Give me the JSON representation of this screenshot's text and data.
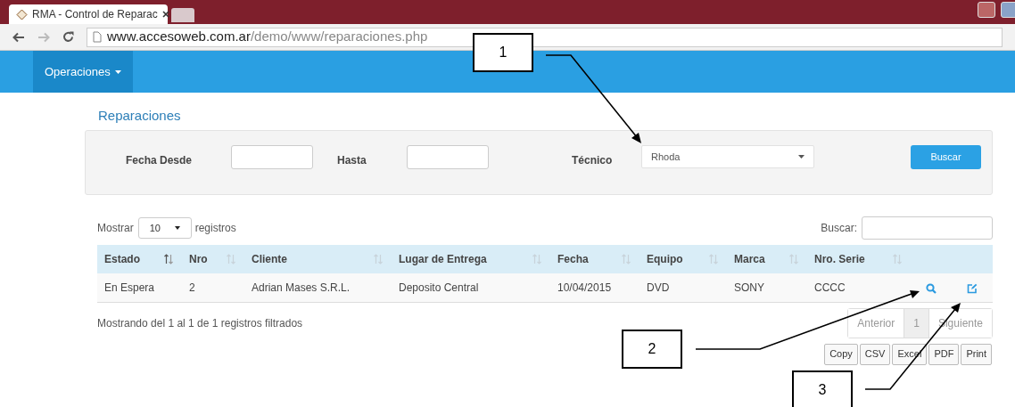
{
  "browser": {
    "tab_title": "RMA - Control de Reparac",
    "address": {
      "domain": "www.accesoweb.com.ar",
      "path": "/demo/www/reparaciones.php"
    }
  },
  "navbar": {
    "menu": "Operaciones"
  },
  "page_title": "Reparaciones",
  "filters": {
    "from_label": "Fecha Desde",
    "to_label": "Hasta",
    "tech_label": "Técnico",
    "tech_value": "Rhoda",
    "button": "Buscar"
  },
  "table_controls": {
    "show_label": "Mostrar",
    "page_size": "10",
    "records_label": "registros",
    "search_label": "Buscar:"
  },
  "table": {
    "columns": [
      {
        "label": "Estado",
        "sorted": true
      },
      {
        "label": "Nro",
        "sorted": false
      },
      {
        "label": "Cliente",
        "sorted": false
      },
      {
        "label": "Lugar de Entrega",
        "sorted": false
      },
      {
        "label": "Fecha",
        "sorted": false
      },
      {
        "label": "Equipo",
        "sorted": false
      },
      {
        "label": "Marca",
        "sorted": false
      },
      {
        "label": "Nro. Serie",
        "sorted": false
      }
    ],
    "rows": [
      {
        "cells": [
          "En Espera",
          "2",
          "Adrian Mases S.R.L.",
          "Deposito Central",
          "10/04/2015",
          "DVD",
          "SONY",
          "CCCC"
        ]
      }
    ]
  },
  "info": "Mostrando del 1 al 1 de 1 registros filtrados",
  "pagination": [
    {
      "label": "Anterior",
      "selected": false,
      "disabled": true
    },
    {
      "label": "1",
      "selected": true,
      "disabled": false
    },
    {
      "label": "Siguiente",
      "selected": false,
      "disabled": true
    }
  ],
  "export_buttons": [
    "Copy",
    "CSV",
    "Excel",
    "PDF",
    "Print"
  ],
  "callouts": [
    {
      "number": "1"
    },
    {
      "number": "2"
    },
    {
      "number": "3"
    }
  ]
}
